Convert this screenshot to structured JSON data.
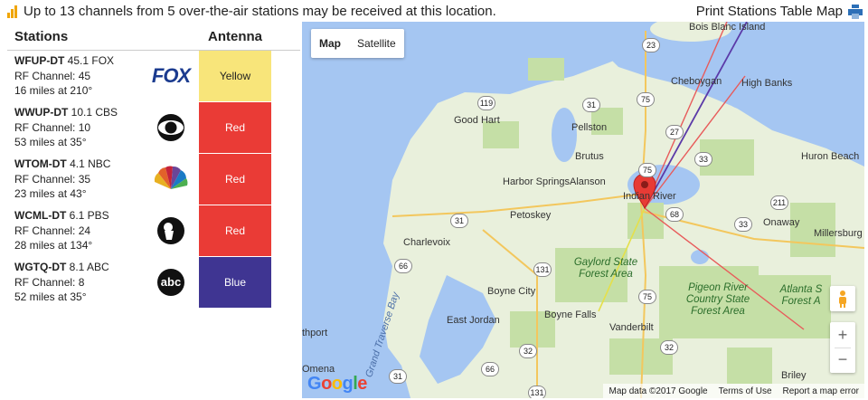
{
  "header": {
    "summary": "Up to 13 channels from 5 over-the-air stations may be received at this location.",
    "print_label": "Print Stations Table Map"
  },
  "table": {
    "col_stations": "Stations",
    "col_antenna": "Antenna",
    "rows": [
      {
        "call": "WFUP-DT",
        "channel": "45.1 FOX",
        "rf": "RF Channel: 45",
        "dist": "16 miles at 210°",
        "antenna": "Yellow",
        "color": "#f8e57a",
        "text_color": "#222",
        "logo": "fox-logo"
      },
      {
        "call": "WWUP-DT",
        "channel": "10.1 CBS",
        "rf": "RF Channel: 10",
        "dist": "53 miles at 35°",
        "antenna": "Red",
        "color": "#ea3b36",
        "text_color": "#fff",
        "logo": "cbs-logo"
      },
      {
        "call": "WTOM-DT",
        "channel": "4.1 NBC",
        "rf": "RF Channel: 35",
        "dist": "23 miles at 43°",
        "antenna": "Red",
        "color": "#ea3b36",
        "text_color": "#fff",
        "logo": "nbc-logo"
      },
      {
        "call": "WCML-DT",
        "channel": "6.1 PBS",
        "rf": "RF Channel: 24",
        "dist": "28 miles at 134°",
        "antenna": "Red",
        "color": "#ea3b36",
        "text_color": "#fff",
        "logo": "pbs-logo"
      },
      {
        "call": "WGTQ-DT",
        "channel": "8.1 ABC",
        "rf": "RF Channel: 8",
        "dist": "52 miles at 35°",
        "antenna": "Blue",
        "color": "#3f3592",
        "text_color": "#fff",
        "logo": "abc-logo"
      }
    ]
  },
  "logos": {
    "fox": "FOX",
    "abc": "abc"
  },
  "map": {
    "type_map": "Map",
    "type_satellite": "Satellite",
    "zoom_in": "+",
    "zoom_out": "−",
    "google": "Google",
    "attribution": [
      "Map data ©2017 Google",
      "Terms of Use",
      "Report a map error"
    ],
    "places": [
      "Bois Blanc Island",
      "Cheboygan",
      "High Banks",
      "Good Hart",
      "Pellston",
      "Brutus",
      "Huron Beach",
      "Harbor Springs",
      "Alanson",
      "Indian River",
      "Petoskey",
      "Onaway",
      "Millersburg",
      "Charlevoix",
      "Boyne City",
      "East Jordan",
      "Boyne Falls",
      "Vanderbilt",
      "thport",
      "Omena",
      "Grand Traverse Bay",
      "Briley"
    ],
    "forests": [
      "Gaylord State Forest Area",
      "Pigeon River Country State Forest Area",
      "Atlanta S Forest A"
    ],
    "routes": [
      "23",
      "75",
      "119",
      "31",
      "27",
      "33",
      "75",
      "68",
      "211",
      "33",
      "31",
      "131",
      "66",
      "75",
      "32",
      "32",
      "66",
      "31",
      "131"
    ]
  }
}
